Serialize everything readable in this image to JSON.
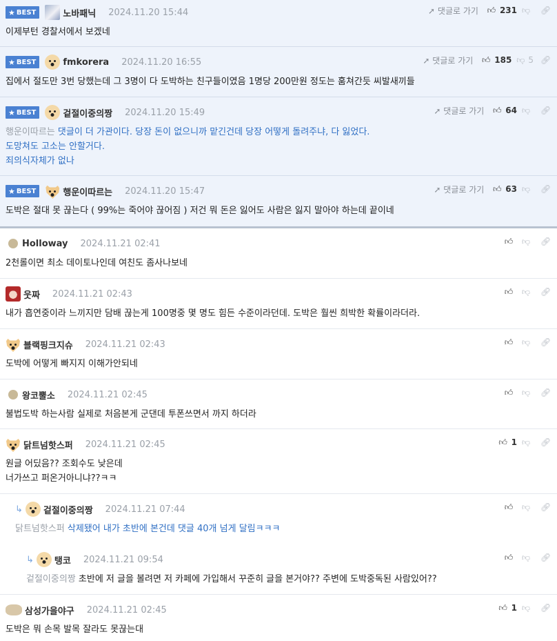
{
  "best_badge": "BEST",
  "reply_label": "댓글로 가기",
  "best_comments": [
    {
      "nick": "노바패닉",
      "date": "2024.11.20 15:44",
      "likes": "231",
      "dislikes": "",
      "text": "이제부턴 경찰서에서 보겠네"
    },
    {
      "nick": "fmkorera",
      "date": "2024.11.20 16:55",
      "likes": "185",
      "dislikes": "5",
      "text": "집에서 절도만 3번 당했는데 그 3명이 다 도박하는 친구들이였음 1명당 200만원 정도는 훔쳐간듯 씨발새끼들"
    },
    {
      "nick": "겉절이중의짱",
      "date": "2024.11.20 15:49",
      "likes": "64",
      "dislikes": "",
      "mention": "행운이따르는",
      "lines": [
        "댓글이 더 가관이다. 당장 돈이 없으니까 맡긴건데 당장 어떻게 돌려주냐, 다 잃었다.",
        "도망쳐도 고소는 안할거다.",
        "죄의식자체가 없나"
      ]
    },
    {
      "nick": "행운이따르는",
      "date": "2024.11.20 15:47",
      "likes": "63",
      "dislikes": "",
      "text": "도박은 절대 못 끊는다 ( 99%는 죽어야 끊어짐 ) 저건 뭐 돈은 잃어도 사람은 잃지 말아야 하는데 끝이네"
    }
  ],
  "comments": [
    {
      "nick": "Holloway",
      "date": "2024.11.21 02:41",
      "likes": "",
      "text": "2천롤이면 최소 데이토나인데 여친도 좀사나보네"
    },
    {
      "nick": "웃짜",
      "date": "2024.11.21 02:43",
      "likes": "",
      "text": "내가 흡연중이라 느끼지만 담배 끊는게 100명중 몇 명도 힘든 수준이라던데. 도박은 훨씬 희박한 확률이라더라."
    },
    {
      "nick": "블랙핑크지슈",
      "date": "2024.11.21 02:43",
      "likes": "",
      "text": "도박에 어떻게 빠지지 이해가안되네"
    },
    {
      "nick": "왕코뿔소",
      "date": "2024.11.21 02:45",
      "likes": "",
      "text": "불법도박 하는사람 실제로 처음본게 군댄데 투폰쓰면서 까지 하더라"
    },
    {
      "nick": "닭트넘핫스퍼",
      "date": "2024.11.21 02:45",
      "likes": "1",
      "lines": [
        "원글 어딨음?? 조회수도 낮은데",
        "너가쓰고 퍼온거아니냐??ㅋㅋ"
      ]
    },
    {
      "nick": "겉절이중의짱",
      "date": "2024.11.21 07:44",
      "likes": "",
      "mention": "닭트넘핫스퍼",
      "text": "삭제됐어 내가 초반에 본건데 댓글 40개 넘게 달림ㅋㅋㅋ"
    },
    {
      "nick": "탱코",
      "date": "2024.11.21 09:54",
      "likes": "",
      "mention": "겉절이중의짱",
      "text": "초반에 저 글을 볼려면 저 카페에 가입해서 꾸준히 글을 본거야?? 주변에 도박중독된 사람있어??"
    },
    {
      "nick": "삼성가을야구",
      "date": "2024.11.21 02:45",
      "likes": "1",
      "text": "도박은 뭐 손목 발목 잘라도 못끊는대"
    }
  ]
}
